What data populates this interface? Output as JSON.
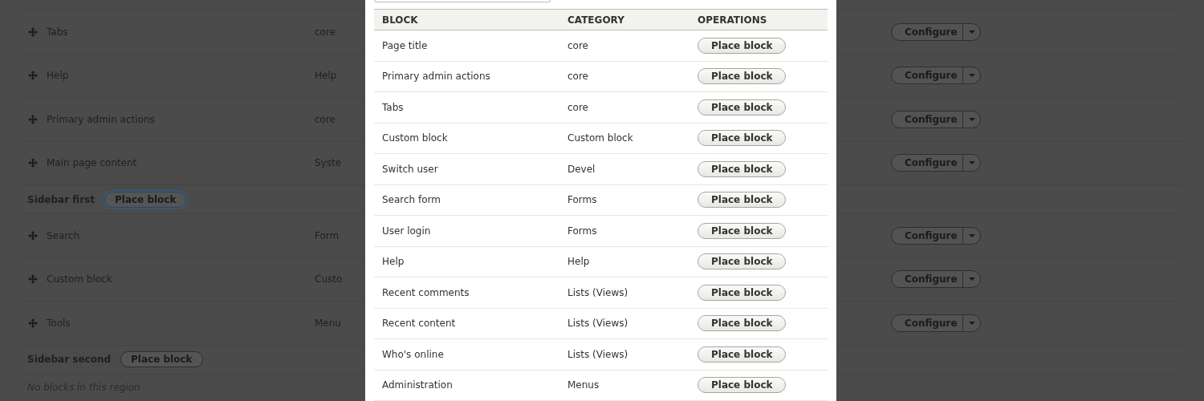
{
  "page": {
    "rows": [
      {
        "kind": "block",
        "name": "Tabs",
        "category": "core",
        "operation": "Configure"
      },
      {
        "kind": "block",
        "name": "Help",
        "category": "Help",
        "operation": "Configure"
      },
      {
        "kind": "block",
        "name": "Primary admin actions",
        "category": "core",
        "operation": "Configure"
      },
      {
        "kind": "block",
        "name": "Main page content",
        "category": "Syste",
        "operation": "Configure"
      },
      {
        "kind": "region",
        "name": "Sidebar first",
        "button": "Place block",
        "focused": true
      },
      {
        "kind": "block",
        "name": "Search",
        "category": "Form",
        "operation": "Configure"
      },
      {
        "kind": "block",
        "name": "Custom block",
        "category": "Custo",
        "operation": "Configure"
      },
      {
        "kind": "block",
        "name": "Tools",
        "category": "Menu",
        "operation": "Configure"
      },
      {
        "kind": "region",
        "name": "Sidebar second",
        "button": "Place block",
        "focused": false
      },
      {
        "kind": "empty",
        "text": "No blocks in this region"
      }
    ]
  },
  "modal": {
    "table": {
      "columns": [
        "BLOCK",
        "CATEGORY",
        "OPERATIONS"
      ],
      "rows": [
        {
          "block": "Page title",
          "category": "core",
          "operation": "Place block"
        },
        {
          "block": "Primary admin actions",
          "category": "core",
          "operation": "Place block"
        },
        {
          "block": "Tabs",
          "category": "core",
          "operation": "Place block"
        },
        {
          "block": "Custom block",
          "category": "Custom block",
          "operation": "Place block"
        },
        {
          "block": "Switch user",
          "category": "Devel",
          "operation": "Place block"
        },
        {
          "block": "Search form",
          "category": "Forms",
          "operation": "Place block"
        },
        {
          "block": "User login",
          "category": "Forms",
          "operation": "Place block"
        },
        {
          "block": "Help",
          "category": "Help",
          "operation": "Place block"
        },
        {
          "block": "Recent comments",
          "category": "Lists (Views)",
          "operation": "Place block"
        },
        {
          "block": "Recent content",
          "category": "Lists (Views)",
          "operation": "Place block"
        },
        {
          "block": "Who's online",
          "category": "Lists (Views)",
          "operation": "Place block"
        },
        {
          "block": "Administration",
          "category": "Menus",
          "operation": "Place block"
        }
      ]
    }
  }
}
